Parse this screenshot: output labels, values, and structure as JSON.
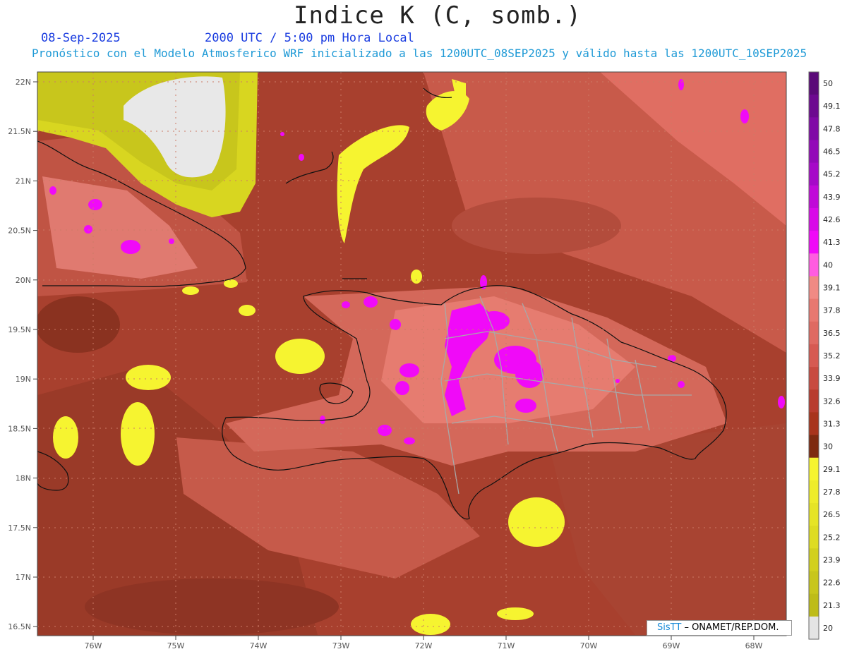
{
  "header": {
    "title": "Indice K (C, somb.)",
    "date": "08-Sep-2025",
    "time": "2000 UTC / 5:00 pm Hora Local",
    "description": "Pronóstico con el Modelo Atmosferico WRF inicializado a las 1200UTC_08SEP2025 y válido hasta las  1200UTC_10SEP2025"
  },
  "axes": {
    "lat_labels": [
      "22N",
      "21.5N",
      "21N",
      "20.5N",
      "20N",
      "19.5N",
      "19N",
      "18.5N",
      "18N",
      "17.5N",
      "17N",
      "16.5N"
    ],
    "lon_labels": [
      "76W",
      "75W",
      "74W",
      "73W",
      "72W",
      "71W",
      "70W",
      "69W",
      "68W"
    ]
  },
  "colorbar": {
    "labels": [
      "50",
      "49.1",
      "47.8",
      "46.5",
      "45.2",
      "43.9",
      "42.6",
      "41.3",
      "40",
      "39.1",
      "37.8",
      "36.5",
      "35.2",
      "33.9",
      "32.6",
      "31.3",
      "30",
      "29.1",
      "27.8",
      "26.5",
      "25.2",
      "23.9",
      "22.6",
      "21.3",
      "20"
    ],
    "colors": [
      "#5a0a78",
      "#6d0a90",
      "#800aa6",
      "#930ab8",
      "#a60ac8",
      "#c00ad8",
      "#d80ae8",
      "#f00af8",
      "#ff5ce0",
      "#f08a84",
      "#e87870",
      "#df6a62",
      "#d65a52",
      "#c84a40",
      "#b83c2e",
      "#a8341c",
      "#7e2a10",
      "#f6f430",
      "#eeec2a",
      "#e6e426",
      "#dedc22",
      "#d2d01e",
      "#c8c61c",
      "#bebc18",
      "#e4e4e4"
    ]
  },
  "credit": {
    "brand": "SisTT",
    "org": "– ONAMET/REP.DOM."
  }
}
